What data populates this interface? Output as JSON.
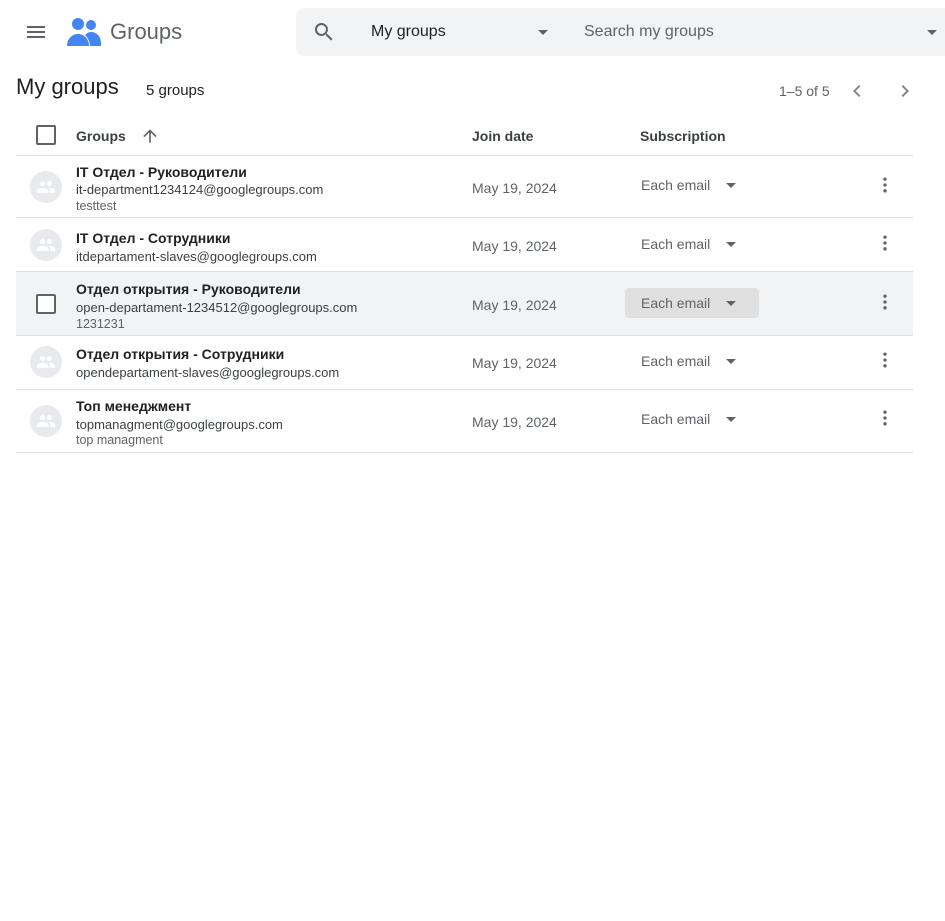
{
  "app": {
    "title": "Groups",
    "brand_color": "#4285f4"
  },
  "header": {
    "menu_icon": "hamburger-menu-icon",
    "search_icon": "search-icon",
    "scope_label": "My groups",
    "search_placeholder": "Search my groups"
  },
  "page": {
    "title": "My groups",
    "count_label": "5 groups",
    "pagination": "1–5 of 5"
  },
  "table": {
    "columns": {
      "groups": "Groups",
      "join_date": "Join date",
      "subscription": "Subscription"
    },
    "sort": "ascending",
    "rows": [
      {
        "name": "IT Отдел - Руководители",
        "email": "it-department1234124@googlegroups.com",
        "description": "testtest",
        "join_date": "May 19, 2024",
        "subscription": "Each email"
      },
      {
        "name": "IT Отдел - Сотрудники",
        "email": "itdepartament-slaves@googlegroups.com",
        "description": "",
        "join_date": "May 19, 2024",
        "subscription": "Each email"
      },
      {
        "name": "Отдел открытия - Руководители",
        "email": "open-departament-1234512@googlegroups.com",
        "description": "1231231",
        "join_date": "May 19, 2024",
        "subscription": "Each email"
      },
      {
        "name": "Отдел открытия - Сотрудники",
        "email": "opendepartament-slaves@googlegroups.com",
        "description": "",
        "join_date": "May 19, 2024",
        "subscription": "Each email"
      },
      {
        "name": "Топ менеджмент",
        "email": "topmanagment@googlegroups.com",
        "description": "top managment",
        "join_date": "May 19, 2024",
        "subscription": "Each email"
      }
    ]
  }
}
